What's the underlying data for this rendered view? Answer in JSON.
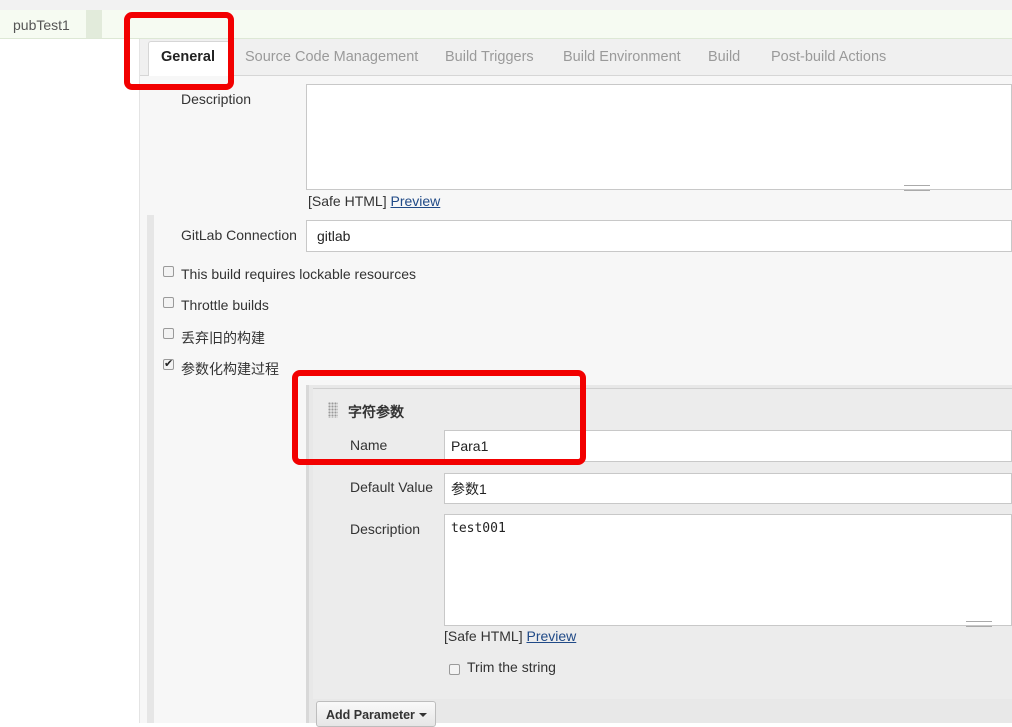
{
  "breadcrumb": {
    "project": "pubTest1"
  },
  "tabs": {
    "general": "General",
    "scm": "Source Code Management",
    "triggers": "Build Triggers",
    "environment": "Build Environment",
    "build": "Build",
    "post_build": "Post-build Actions"
  },
  "general": {
    "description_label": "Description",
    "description_value": "",
    "safe_html": "[Safe HTML]",
    "preview": "Preview",
    "gitlab_label": "GitLab Connection",
    "gitlab_value": "gitlab",
    "options": [
      {
        "label": "This build requires lockable resources",
        "checked": false
      },
      {
        "label": "Throttle builds",
        "checked": false
      },
      {
        "label": "丢弃旧的构建",
        "checked": false
      },
      {
        "label": "参数化构建过程",
        "checked": true
      }
    ]
  },
  "parameter": {
    "type_title": "字符参数",
    "name_label": "Name",
    "name_value": "Para1",
    "default_label": "Default Value",
    "default_value": "参数1",
    "description_label": "Description",
    "description_value": "test001",
    "safe_html": "[Safe HTML]",
    "preview": "Preview",
    "trim_label": "Trim the string",
    "trim_checked": false,
    "add_button": "Add Parameter"
  },
  "annotation_color": "#f20000"
}
